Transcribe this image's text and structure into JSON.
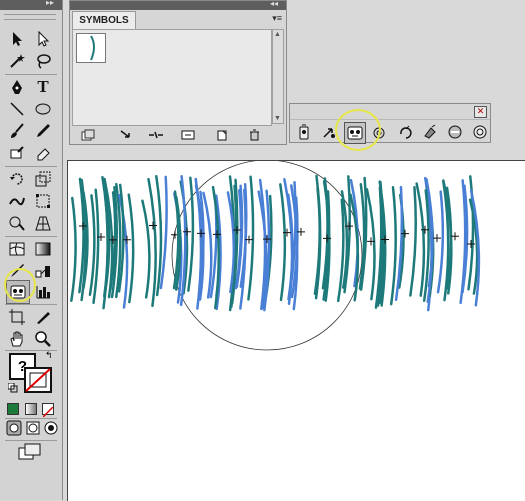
{
  "symbols_panel": {
    "tab_label": "SYMBOLS",
    "menu_glyph": "▾≡",
    "collapse_glyph": "◂◂",
    "bottom_buttons": [
      "symbol-libraries-icon",
      "place-symbol-icon",
      "break-link-icon",
      "symbol-options-icon",
      "new-symbol-icon",
      "delete-symbol-icon"
    ]
  },
  "tools_panel": {
    "collapse_glyph": "▸▸",
    "type_tool_label": "T",
    "mode_label": "?"
  },
  "symbolism_toolbar": {
    "close_glyph": "✕",
    "tools": [
      "symbol-sprayer",
      "symbol-shifter",
      "symbol-scruncher",
      "symbol-sizer",
      "symbol-spinner",
      "symbol-stainer",
      "symbol-screener",
      "symbol-styler"
    ],
    "selected_tool": "symbol-scruncher"
  },
  "colors": {
    "stroke_teal": "#1e7a7a",
    "stroke_blue": "#4a7fd6",
    "highlight": "#e6e64a",
    "panel_bg": "#d6d6d6"
  }
}
